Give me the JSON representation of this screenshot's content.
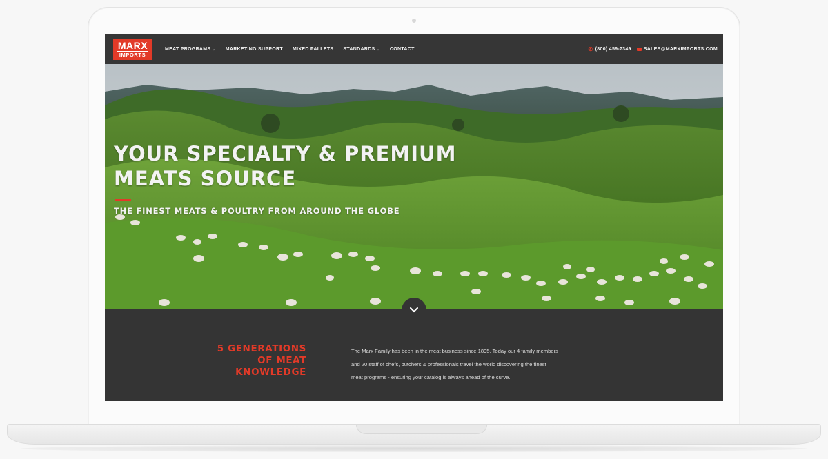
{
  "brand": {
    "logo_line1": "MARX",
    "logo_line2": "IMPORTS",
    "accent_color": "#e23a28",
    "nav_bg": "#363636"
  },
  "nav": {
    "items": [
      {
        "label": "MEAT PROGRAMS",
        "has_dropdown": true
      },
      {
        "label": "MARKETING SUPPORT",
        "has_dropdown": false
      },
      {
        "label": "MIXED PALLETS",
        "has_dropdown": false
      },
      {
        "label": "STANDARDS",
        "has_dropdown": true
      },
      {
        "label": "CONTACT",
        "has_dropdown": false
      }
    ],
    "phone": "(800) 459-7349",
    "email": "SALES@MARXIMPORTS.COM",
    "icons": {
      "phone": "phone-icon",
      "email": "envelope-icon",
      "dropdown": "chevron-down-icon"
    }
  },
  "hero": {
    "title_line1": "YOUR SPECIALTY & PREMIUM",
    "title_line2": "MEATS SOURCE",
    "subtitle": "THE FINEST MEATS & POULTRY FROM AROUND THE GLOBE",
    "scroll_icon": "chevron-down-icon"
  },
  "intro": {
    "heading_line1": "5 GENERATIONS",
    "heading_line2": "OF MEAT",
    "heading_line3": "KNOWLEDGE",
    "body_line1": "The Marx Family has been in the meat business since 1895. Today our 4 family members",
    "body_line2": "and 20 staff of chefs, butchers & professionals travel the world discovering the finest",
    "body_line3": "meat programs - ensuring your catalog is always ahead of the curve."
  }
}
